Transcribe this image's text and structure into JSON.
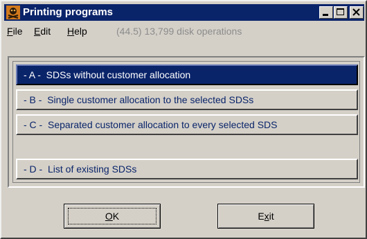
{
  "window": {
    "title": "Printing programs",
    "colors": {
      "titlebar": "#0a246a",
      "face": "#d4d0c8",
      "accent_text": "#0a246a"
    }
  },
  "menu": {
    "file": {
      "first": "F",
      "rest": "ile"
    },
    "edit": {
      "first": "E",
      "rest": "dit"
    },
    "help": {
      "first": "H",
      "rest": "elp"
    },
    "status": "(44.5) 13,799 disk operations"
  },
  "options": [
    {
      "label": "- A -  SDSs without customer allocation",
      "selected": true
    },
    {
      "label": "- B -  Single customer allocation to the selected SDSs",
      "selected": false
    },
    {
      "label": "- C -  Separated customer allocation to every selected SDS",
      "selected": false
    },
    {
      "label": "- D -  List of existing SDSs",
      "selected": false
    }
  ],
  "buttons": {
    "ok": {
      "first": "O",
      "rest": "K"
    },
    "exit": {
      "pre": "E",
      "under": "x",
      "rest": "it"
    }
  },
  "icons": [
    "app-icon",
    "minimize-icon",
    "maximize-icon",
    "close-icon"
  ]
}
